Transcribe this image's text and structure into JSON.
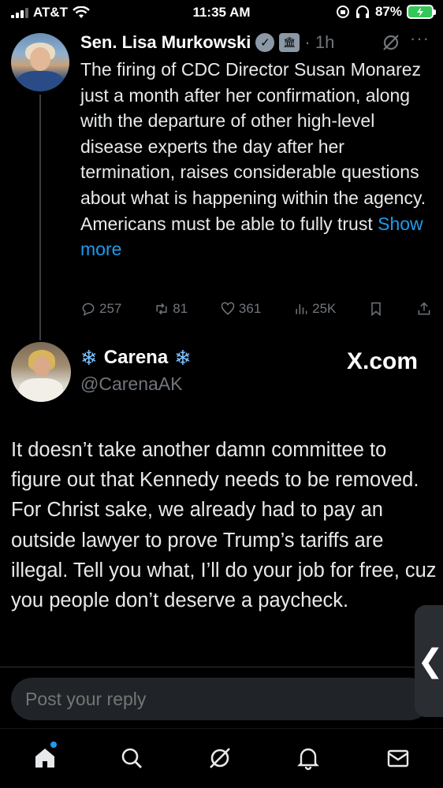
{
  "status_bar": {
    "carrier": "AT&T",
    "time": "11:35 AM",
    "battery_percent": "87%"
  },
  "quoted_tweet": {
    "author_name": "Sen. Lisa Murkowski",
    "time_ago": "· 1h",
    "text": "The firing of CDC Director Susan Monarez just a month after her confirmation, along with the departure of other high-level disease experts the day after her termination, raises considerable questions about what is happening within the agency. Americans must be able to fully trust",
    "show_more": "Show more",
    "replies": "257",
    "reposts": "81",
    "likes": "361",
    "views": "25K"
  },
  "reply": {
    "author_name": "Carena",
    "handle": "@CarenaAK",
    "affiliation": "X.com",
    "text": "It doesn’t take another damn committee to figure out that Kennedy needs to be removed. For Christ sake, we already had to pay an outside lawyer to prove Trump’s tariffs are illegal. Tell you what, I’ll do your job for free, cuz you people don’t deserve a paycheck."
  },
  "compose": {
    "placeholder": "Post your reply"
  },
  "side_handle_glyph": "❮",
  "colors": {
    "background": "#000000",
    "text": "#e7e9ea",
    "muted": "#71767b",
    "link": "#1d9bf0",
    "battery": "#34c759"
  },
  "icons": [
    "wifi-icon",
    "orientation-lock-icon",
    "headphones-icon",
    "battery-icon",
    "verified-badge-icon",
    "government-badge-icon",
    "grok-icon",
    "more-icon",
    "reply-icon",
    "repost-icon",
    "like-icon",
    "views-icon",
    "bookmark-icon",
    "share-icon",
    "home-icon",
    "search-icon",
    "notifications-icon",
    "messages-icon"
  ]
}
